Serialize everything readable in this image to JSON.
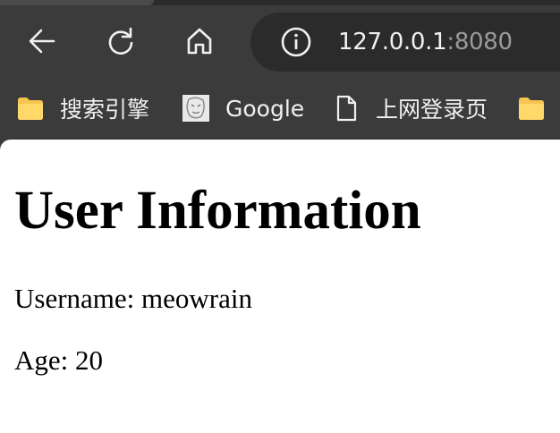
{
  "browser": {
    "address_bar": {
      "host": "127.0.0.1",
      "port": ":8080"
    },
    "toolbar_icons": [
      "back-arrow-icon",
      "reload-icon",
      "home-icon",
      "info-icon"
    ],
    "bookmarks": [
      {
        "label": "搜索引擎",
        "icon": "folder-icon"
      },
      {
        "label": "Google",
        "icon": "site-favicon"
      },
      {
        "label": "上网登录页",
        "icon": "page-icon"
      },
      {
        "label": "",
        "icon": "folder-icon"
      }
    ],
    "colors": {
      "chrome_bg": "#3b3b3b",
      "omnibox_bg": "#2b2b2b",
      "folder_yellow": "#f5c451",
      "text_light": "#f1f1f1",
      "text_dim": "#9a9a9a"
    }
  },
  "page": {
    "heading": "User Information",
    "username_line": "Username: meowrain",
    "age_line": "Age: 20"
  }
}
